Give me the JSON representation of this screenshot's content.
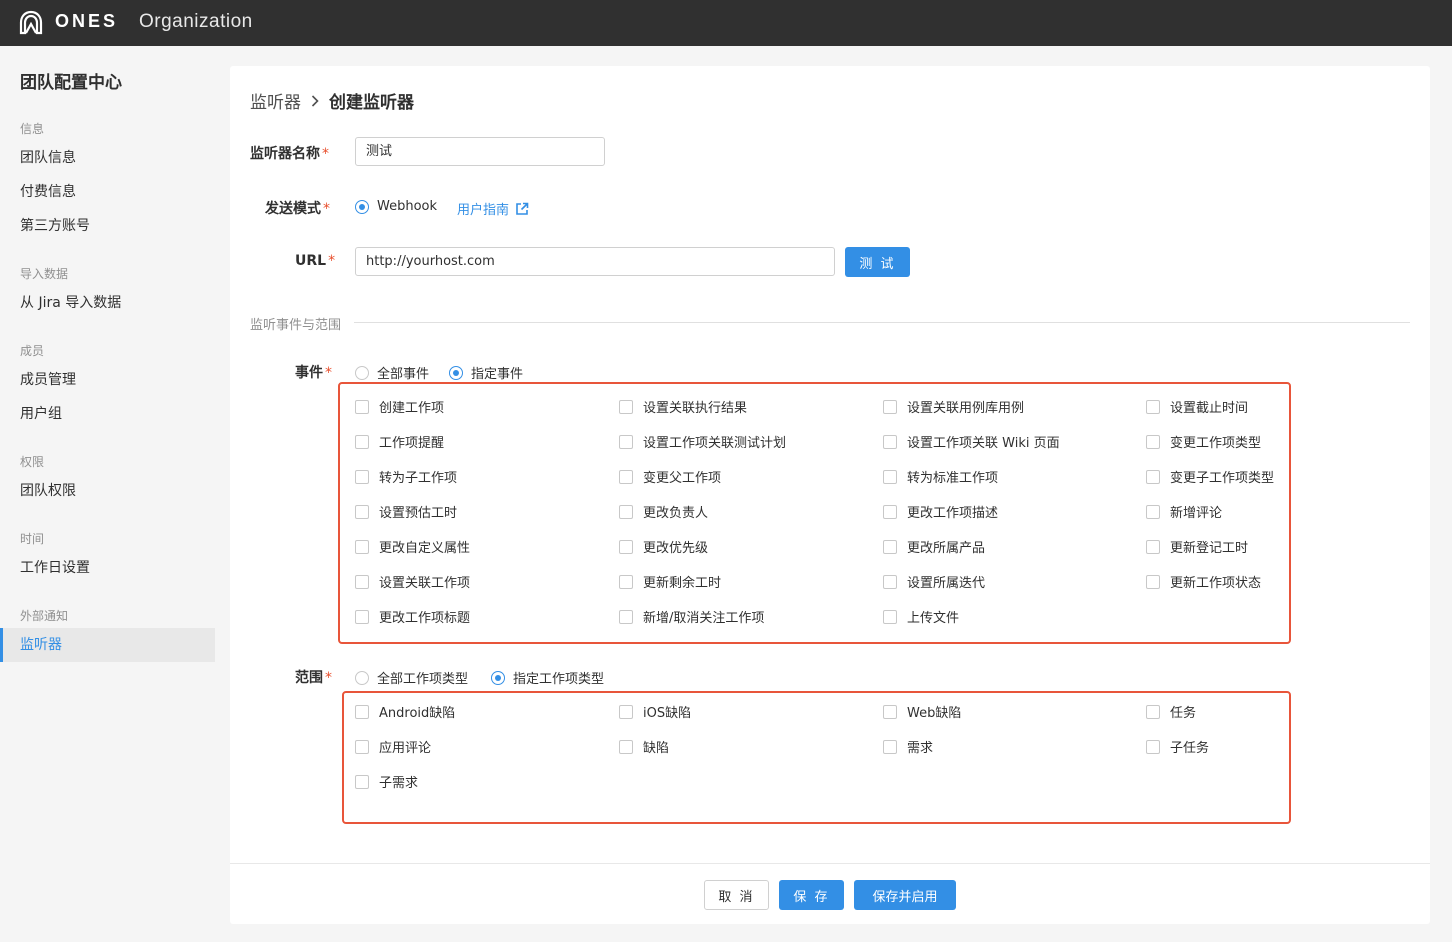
{
  "topbar": {
    "brand": "ONES",
    "product": "Organization"
  },
  "sidebar": {
    "title": "团队配置中心",
    "groups": [
      {
        "label": "信息",
        "items": [
          "团队信息",
          "付费信息",
          "第三方账号"
        ]
      },
      {
        "label": "导入数据",
        "items": [
          "从 Jira 导入数据"
        ]
      },
      {
        "label": "成员",
        "items": [
          "成员管理",
          "用户组"
        ]
      },
      {
        "label": "权限",
        "items": [
          "团队权限"
        ]
      },
      {
        "label": "时间",
        "items": [
          "工作日设置"
        ]
      },
      {
        "label": "外部通知",
        "items": [
          "监听器"
        ]
      }
    ],
    "active_item": "监听器"
  },
  "breadcrumb": {
    "parent": "监听器",
    "separator": ">",
    "current": "创建监听器"
  },
  "form": {
    "name_label": "监听器名称",
    "name_value": "测试",
    "mode_label": "发送模式",
    "mode_option": "Webhook",
    "guide_link": "用户指南",
    "url_label": "URL",
    "url_value": "http://yourhost.com",
    "test_button": "测 试",
    "section_title": "监听事件与范围",
    "event_label": "事件",
    "event_all": "全部事件",
    "event_specified": "指定事件",
    "events": [
      [
        "创建工作项",
        "设置关联执行结果",
        "设置关联用例库用例",
        "设置截止时间"
      ],
      [
        "工作项提醒",
        "设置工作项关联测试计划",
        "设置工作项关联 Wiki 页面",
        "变更工作项类型"
      ],
      [
        "转为子工作项",
        "变更父工作项",
        "转为标准工作项",
        "变更子工作项类型"
      ],
      [
        "设置预估工时",
        "更改负责人",
        "更改工作项描述",
        "新增评论"
      ],
      [
        "更改自定义属性",
        "更改优先级",
        "更改所属产品",
        "更新登记工时"
      ],
      [
        "设置关联工作项",
        "更新剩余工时",
        "设置所属迭代",
        "更新工作项状态"
      ],
      [
        "更改工作项标题",
        "新增/取消关注工作项",
        "上传文件"
      ]
    ],
    "scope_label": "范围",
    "scope_all": "全部工作项类型",
    "scope_specified": "指定工作项类型",
    "scopes": [
      [
        "Android缺陷",
        "iOS缺陷",
        "Web缺陷",
        "任务"
      ],
      [
        "应用评论",
        "缺陷",
        "需求",
        "子任务"
      ],
      [
        "子需求"
      ]
    ],
    "required_mark": "*"
  },
  "footer": {
    "cancel": "取 消",
    "save": "保 存",
    "save_enable": "保存并启用"
  },
  "colors": {
    "primary": "#338fe5",
    "highlight_box": "#e8553a",
    "topbar": "#303030"
  }
}
